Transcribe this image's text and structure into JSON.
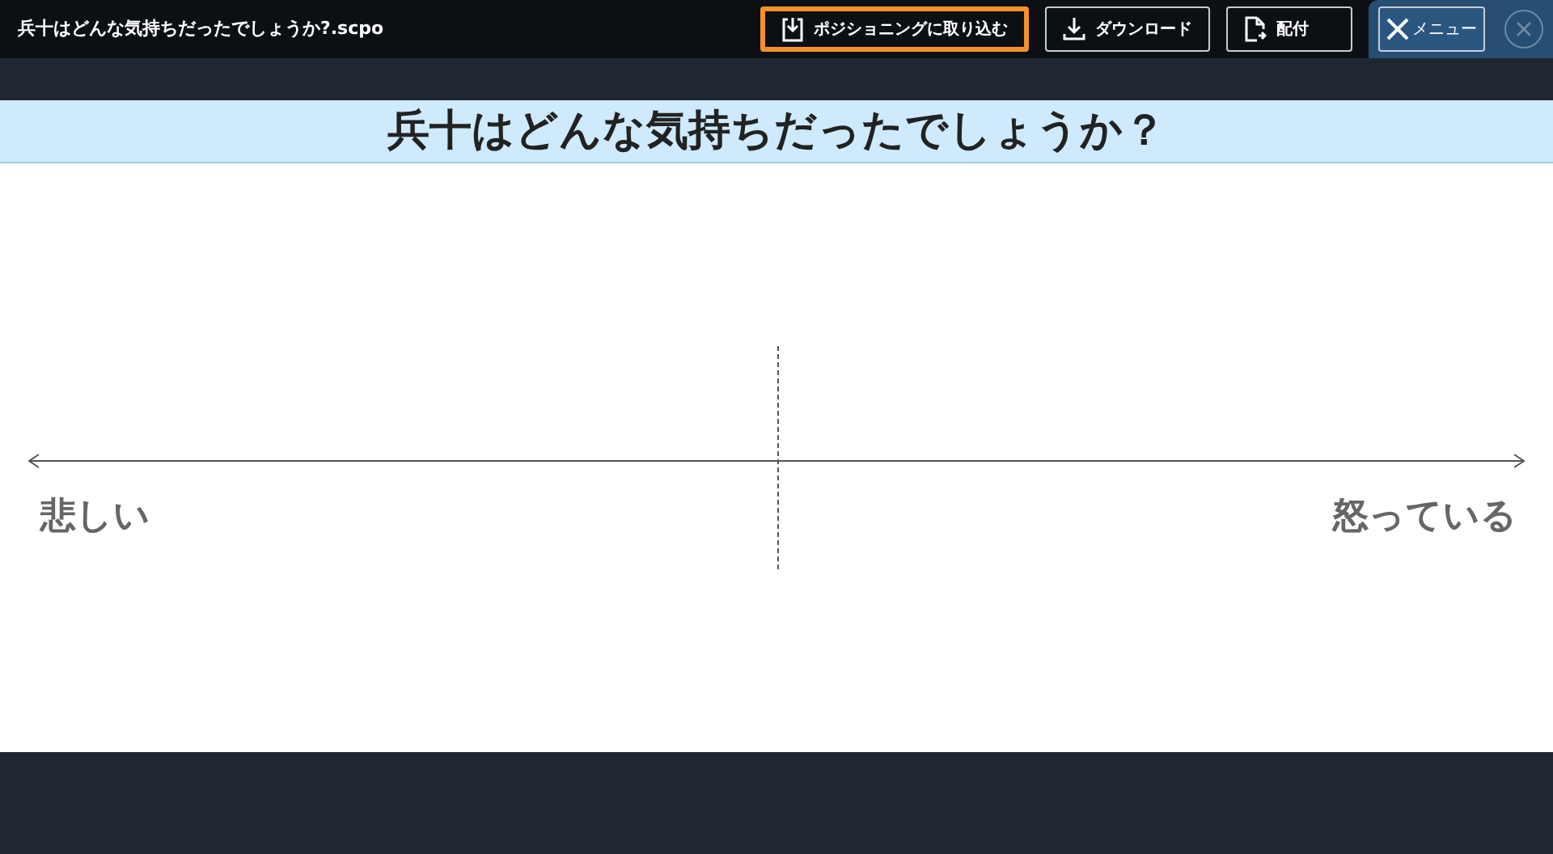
{
  "window": {
    "title": "兵十はどんな気持ちだったでしょうか?.scpo"
  },
  "toolbar": {
    "buttons": [
      {
        "kind": "import",
        "label": "ポジショニングに取り込む",
        "highlighted": true
      },
      {
        "kind": "download",
        "label": "ダウンロード",
        "highlighted": false
      },
      {
        "kind": "distribute",
        "label": "配付",
        "highlighted": false
      }
    ],
    "menu_button": {
      "label": "メニュー"
    }
  },
  "board": {
    "question": "兵十はどんな気持ちだったでしょうか？",
    "left_label": "悲しい",
    "right_label": "怒っている"
  }
}
